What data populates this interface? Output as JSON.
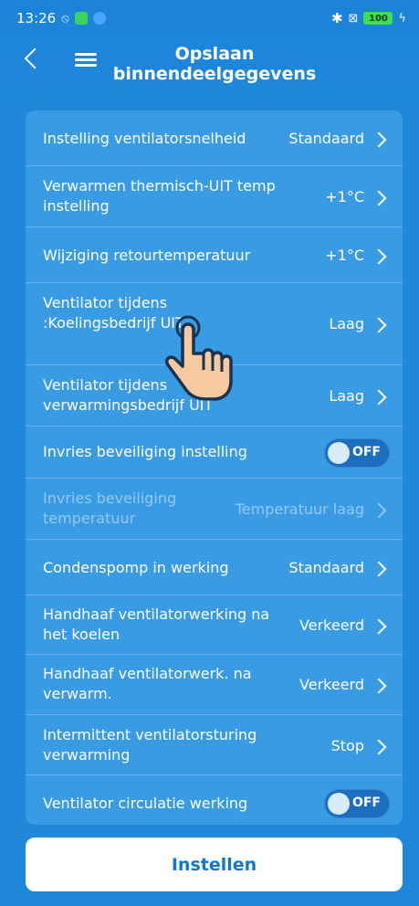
{
  "status_bar": {
    "time": "13:26",
    "battery": "100"
  },
  "header": {
    "title_line1": "Opslaan",
    "title_line2": "binnendeelgegevens"
  },
  "settings": [
    {
      "label": "Instelling ventilatorsnelheid",
      "value": "Standaard"
    },
    {
      "label": "Verwarmen thermisch-UIT temp instelling",
      "value": "+1°C"
    },
    {
      "label": "Wijziging retourtemperatuur",
      "value": "+1°C"
    },
    {
      "label": "Ventilator tijdens :Koelingsbedrijf UIT",
      "value": "Laag"
    },
    {
      "label": "Ventilator tijdens verwarmingsbedrijf UIT",
      "value": "Laag"
    },
    {
      "label": "Invries beveiliging instelling",
      "toggle": "OFF"
    },
    {
      "label": "Invries beveiliging temperatuur",
      "value": "Temperatuur laag"
    },
    {
      "label": "Condenspomp in werking",
      "value": "Standaard"
    },
    {
      "label": "Handhaaf ventilatorwerking na het koelen",
      "value": "Verkeerd"
    },
    {
      "label": "Handhaaf ventilatorwerk. na verwarm.",
      "value": "Verkeerd"
    },
    {
      "label": "Intermittent ventilatorsturing verwarming",
      "value": "Stop"
    },
    {
      "label": "Ventilator circulatie werking",
      "toggle": "OFF"
    }
  ],
  "footer": {
    "button_label": "Instellen"
  }
}
